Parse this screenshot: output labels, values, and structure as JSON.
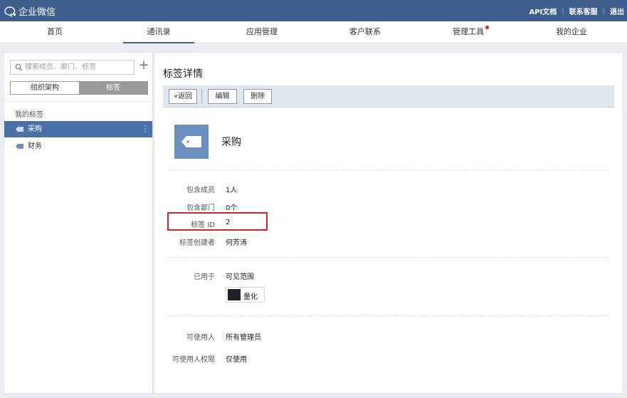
{
  "header": {
    "logo_text": "企业微信",
    "links": [
      "API文档",
      "联系客服",
      "退出"
    ]
  },
  "nav": {
    "items": [
      "首页",
      "通讯录",
      "应用管理",
      "客户联系",
      "管理工具",
      "我的企业"
    ],
    "active": "通讯录"
  },
  "sidebar": {
    "search_placeholder": "搜索成员、部门、标签",
    "tabs": [
      "组织架构",
      "标签"
    ],
    "active_tab": "标签",
    "section_title": "我的标签",
    "tags": [
      "采购",
      "财务"
    ],
    "selected_tag": "采购"
  },
  "detail": {
    "title": "标签详情",
    "toolbar": {
      "back": "返回",
      "edit": "编辑",
      "delete": "删除"
    },
    "tag_name": "采购",
    "members_label": "包含成员",
    "members_value": "1人",
    "depts_label": "包含部门",
    "depts_value": "0个",
    "tagid_label": "标签 ID",
    "tagid_value": "2",
    "creator_label": "标签创建者",
    "creator_value": "何芳涛",
    "usedfor_label": "已用于",
    "usedfor_value": "可见范围",
    "app_name": "量化",
    "users_label": "可使用人",
    "users_value": "所有管理员",
    "perm_label": "可使用人权限",
    "perm_value": "仅使用"
  },
  "colors": {
    "header_bg": "#3e5e8e",
    "selected_bg": "#4a70a8",
    "highlight": "#e02020"
  }
}
